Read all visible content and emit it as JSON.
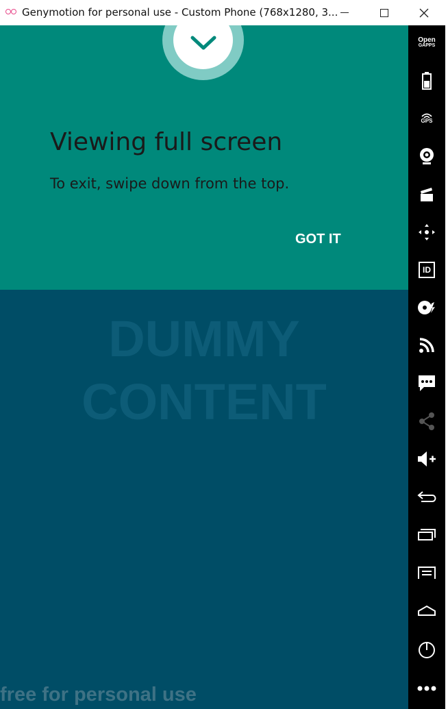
{
  "window": {
    "title": "Genymotion for personal use - Custom Phone (768x1280, 3...",
    "controls": {
      "minimize": "minimize-button",
      "maximize": "maximize-button",
      "close": "close-button"
    }
  },
  "dialog": {
    "title": "Viewing full screen",
    "body": "To exit, swipe down from the top.",
    "button": "GOT IT",
    "accent_color": "#00897b"
  },
  "content": {
    "dummy_line1": "DUMMY",
    "dummy_line2": "CONTENT",
    "background_color": "#004d66"
  },
  "watermark": "free for personal use",
  "toolbar": {
    "open_gapps_line1": "Open",
    "open_gapps_line2": "GAPPS",
    "gps_label": "GPS",
    "id_label": "ID",
    "tools": [
      "open-gapps-icon",
      "battery-icon",
      "gps-icon",
      "webcam-icon",
      "capture-icon",
      "move-icon",
      "device-id-icon",
      "disk-io-icon",
      "network-icon",
      "sms-icon",
      "share-icon",
      "volume-up-icon",
      "back-icon",
      "recent-apps-icon",
      "menu-icon",
      "home-icon",
      "power-icon",
      "more-icon"
    ]
  }
}
